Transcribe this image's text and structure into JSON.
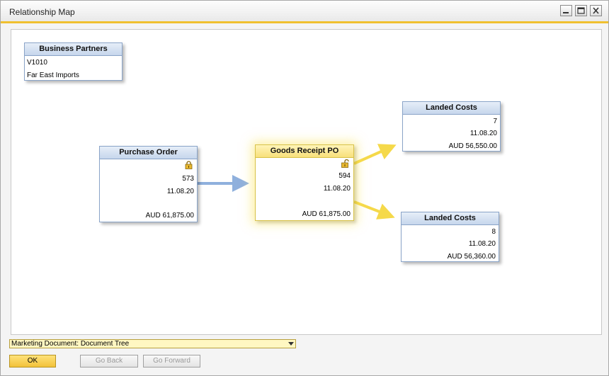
{
  "window": {
    "title": "Relationship Map"
  },
  "business_partner": {
    "header": "Business Partners",
    "code": "V1010",
    "name": "Far East Imports"
  },
  "purchase_order": {
    "header": "Purchase Order",
    "number": "573",
    "date": "11.08.20",
    "total": "AUD 61,875.00",
    "icon": "lock-icon"
  },
  "goods_receipt": {
    "header": "Goods Receipt PO",
    "number": "594",
    "date": "11.08.20",
    "total": "AUD 61,875.00",
    "icon": "lock-icon"
  },
  "landed_costs": [
    {
      "header": "Landed Costs",
      "number": "7",
      "date": "11.08.20",
      "total": "AUD 56,550.00"
    },
    {
      "header": "Landed Costs",
      "number": "8",
      "date": "11.08.20",
      "total": "AUD 56,360.00"
    }
  ],
  "footer": {
    "view_select": "Marketing Document: Document Tree",
    "ok_label": "OK",
    "back_label": "Go Back",
    "forward_label": "Go Forward"
  },
  "colors": {
    "accent": "#f0c030",
    "arrow_base": "#8fb0dd",
    "arrow_target": "#f5d94a"
  }
}
